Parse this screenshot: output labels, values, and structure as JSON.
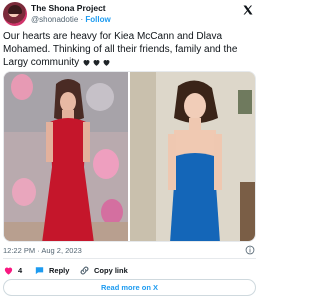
{
  "tweet": {
    "display_name": "The Shona Project",
    "handle": "@shonadotie",
    "separator": "·",
    "follow_label": "Follow",
    "text": "Our hearts are heavy for Kiea McCann and Dlava Mohamed. Thinking of all their friends, family and the Largy community",
    "emoji": [
      "black-heart",
      "black-heart",
      "black-heart"
    ],
    "timestamp": "12:22 PM · Aug 2, 2023",
    "like_count": "4",
    "reply_label": "Reply",
    "copy_link_label": "Copy link",
    "read_more_label": "Read more on X"
  },
  "icons": {
    "logo": "x-logo-icon",
    "info": "info-icon",
    "like": "heart-icon",
    "reply": "speech-bubble-icon",
    "copy": "link-icon"
  },
  "colors": {
    "accent": "#1d9bf0",
    "like": "#f91880",
    "text": "#0f1419",
    "muted": "#536471"
  }
}
